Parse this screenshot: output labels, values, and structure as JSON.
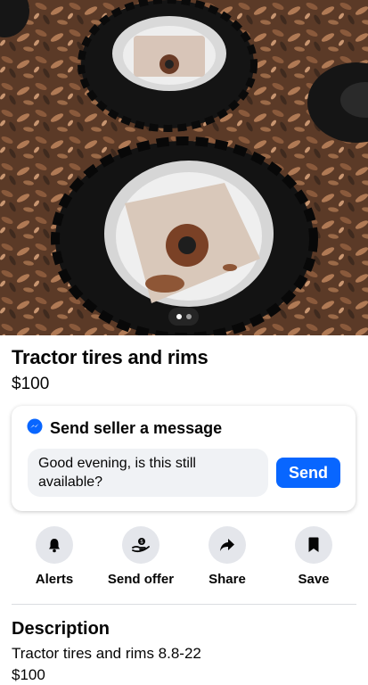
{
  "listing": {
    "title": "Tractor tires and rims",
    "price": "$100",
    "photo": {
      "image_count": 2,
      "active_index": 0
    }
  },
  "message": {
    "heading": "Send seller a message",
    "input_value": "Good evening, is this still available?",
    "send_label": "Send",
    "icon": "messenger-icon"
  },
  "actions": [
    {
      "label": "Alerts",
      "icon": "bell-icon"
    },
    {
      "label": "Send offer",
      "icon": "offer-hand-icon"
    },
    {
      "label": "Share",
      "icon": "share-arrow-icon"
    },
    {
      "label": "Save",
      "icon": "bookmark-icon"
    }
  ],
  "description": {
    "heading": "Description",
    "line1": "Tractor tires and rims 8.8-22",
    "line2": "$100"
  },
  "colors": {
    "accent": "#0866ff",
    "card_bg": "#ffffff",
    "input_bg": "#f0f2f5",
    "action_circle": "#e4e6eb"
  }
}
